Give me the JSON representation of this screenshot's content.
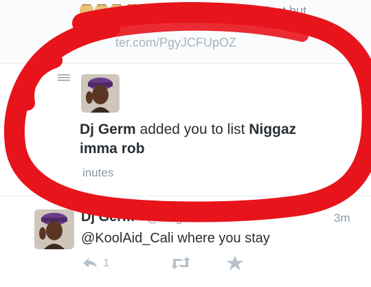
{
  "top_tweet": {
    "text": "might be a college student but",
    "link": "ter.com/PgyJCFUpOZ"
  },
  "notification": {
    "actor": "Dj Germ",
    "action_text": " added you to list ",
    "list_name": "Niggaz imma rob",
    "time": "inutes"
  },
  "tweet": {
    "name": "Dj Germ",
    "handle": "@KingOfThisHill",
    "time": "3m",
    "body": "@KoolAid_Cali where you stay",
    "reply_count": "1"
  },
  "icons": {
    "list": "list-icon",
    "reply": "reply-icon",
    "retweet": "retweet-icon",
    "favorite": "star-icon"
  },
  "colors": {
    "scribble": "#e8141c",
    "text": "#292f33",
    "muted": "#8899a6"
  }
}
